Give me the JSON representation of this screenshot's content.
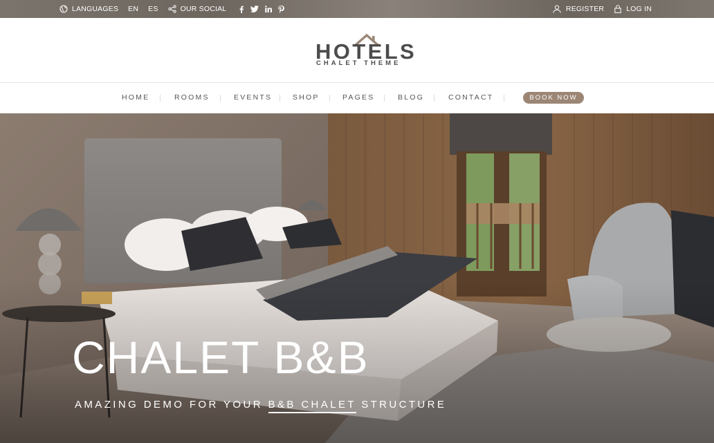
{
  "topbar": {
    "languages_label": "LANGUAGES",
    "lang_en": "EN",
    "lang_es": "ES",
    "social_label": "OUR SOCIAL",
    "social_icons": [
      "facebook-icon",
      "twitter-icon",
      "linkedin-icon",
      "pinterest-icon"
    ],
    "register_label": "REGISTER",
    "login_label": "LOG IN"
  },
  "logo": {
    "main": "HOTELS",
    "sub": "CHALET THEME"
  },
  "nav": {
    "items": [
      "HOME",
      "ROOMS",
      "EVENTS",
      "SHOP",
      "PAGES",
      "BLOG",
      "CONTACT"
    ],
    "cta": "BOOK NOW"
  },
  "hero": {
    "title": "CHALET B&B",
    "subtitle_before": "AMAZING DEMO FOR YOUR ",
    "subtitle_highlight": "B&B CHALET",
    "subtitle_after": " STRUCTURE"
  },
  "colors": {
    "accent": "#9b8676",
    "logo_text": "#4c4c4c",
    "roof": "#9b8676"
  }
}
